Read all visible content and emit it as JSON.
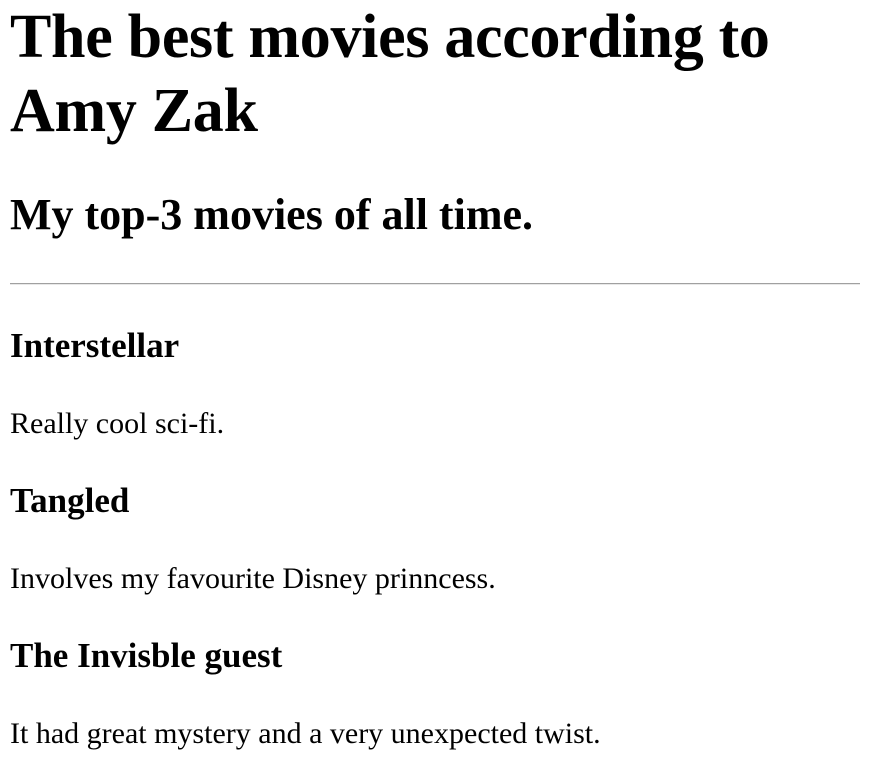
{
  "page": {
    "title": "The best movies according to Amy Zak",
    "subtitle": "My top-3 movies of all time."
  },
  "movies": [
    {
      "title": "Interstellar",
      "description": "Really cool sci-fi."
    },
    {
      "title": "Tangled",
      "description": "Involves my favourite Disney prinncess."
    },
    {
      "title": "The Invisble guest",
      "description": "It had great mystery and a very unexpected twist."
    }
  ]
}
